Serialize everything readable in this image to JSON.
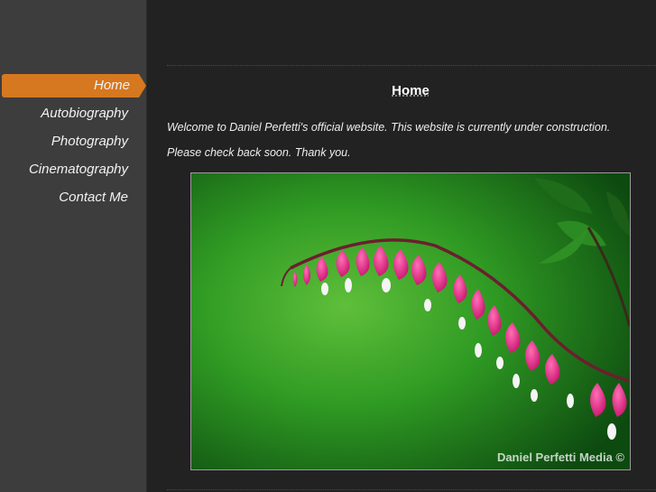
{
  "nav": {
    "items": [
      {
        "label": "Home"
      },
      {
        "label": "Autobiography"
      },
      {
        "label": "Photography"
      },
      {
        "label": "Cinematography"
      },
      {
        "label": "Contact Me"
      }
    ],
    "active_color": "#d6781f"
  },
  "page": {
    "title": "Home",
    "welcome_line1": "Welcome to Daniel Perfetti's official website. This website is currently under construction.",
    "welcome_line2": "Please check back soon. Thank you."
  },
  "photo": {
    "subject": "bleeding heart flowers on green background",
    "watermark": "Daniel Perfetti Media ©"
  }
}
